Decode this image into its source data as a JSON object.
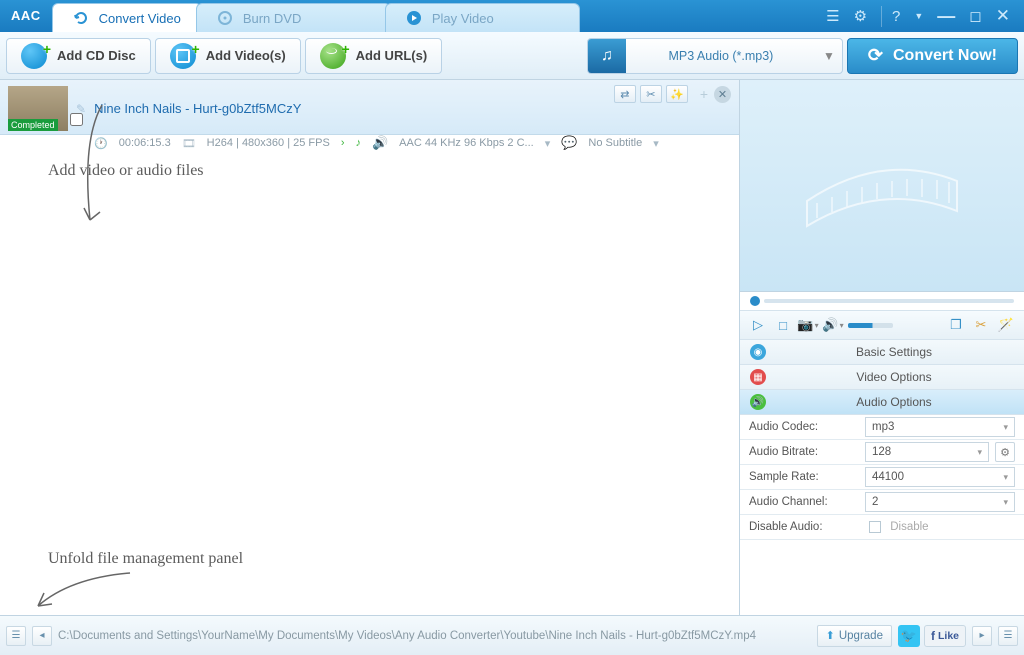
{
  "app": {
    "name": "AAC"
  },
  "tabs": [
    {
      "label": "Convert Video",
      "active": true
    },
    {
      "label": "Burn DVD",
      "active": false
    },
    {
      "label": "Play Video",
      "active": false
    }
  ],
  "toolbar": {
    "add_cd": "Add CD Disc",
    "add_videos": "Add Video(s)",
    "add_urls": "Add URL(s)",
    "format": "MP3 Audio (*.mp3)",
    "convert": "Convert Now!"
  },
  "file": {
    "title": "Nine Inch Nails - Hurt-g0bZtf5MCzY",
    "status": "Completed",
    "duration": "00:06:15.3",
    "video_info": "H264 | 480x360 | 25 FPS",
    "audio_info": "AAC 44 KHz 96 Kbps 2 C...",
    "subtitle": "No Subtitle"
  },
  "annotations": {
    "add_files": "Add video or audio files",
    "unfold": "Unfold file management panel"
  },
  "settings": {
    "basic_tab": "Basic Settings",
    "video_tab": "Video Options",
    "audio_tab": "Audio Options",
    "rows": {
      "codec_label": "Audio Codec:",
      "codec_value": "mp3",
      "bitrate_label": "Audio Bitrate:",
      "bitrate_value": "128",
      "sample_label": "Sample Rate:",
      "sample_value": "44100",
      "channel_label": "Audio Channel:",
      "channel_value": "2",
      "disable_label": "Disable Audio:",
      "disable_value": "Disable"
    }
  },
  "statusbar": {
    "path": "C:\\Documents and Settings\\YourName\\My Documents\\My Videos\\Any Audio Converter\\Youtube\\Nine Inch Nails - Hurt-g0bZtf5MCzY.mp4",
    "upgrade": "Upgrade",
    "like": "Like"
  }
}
